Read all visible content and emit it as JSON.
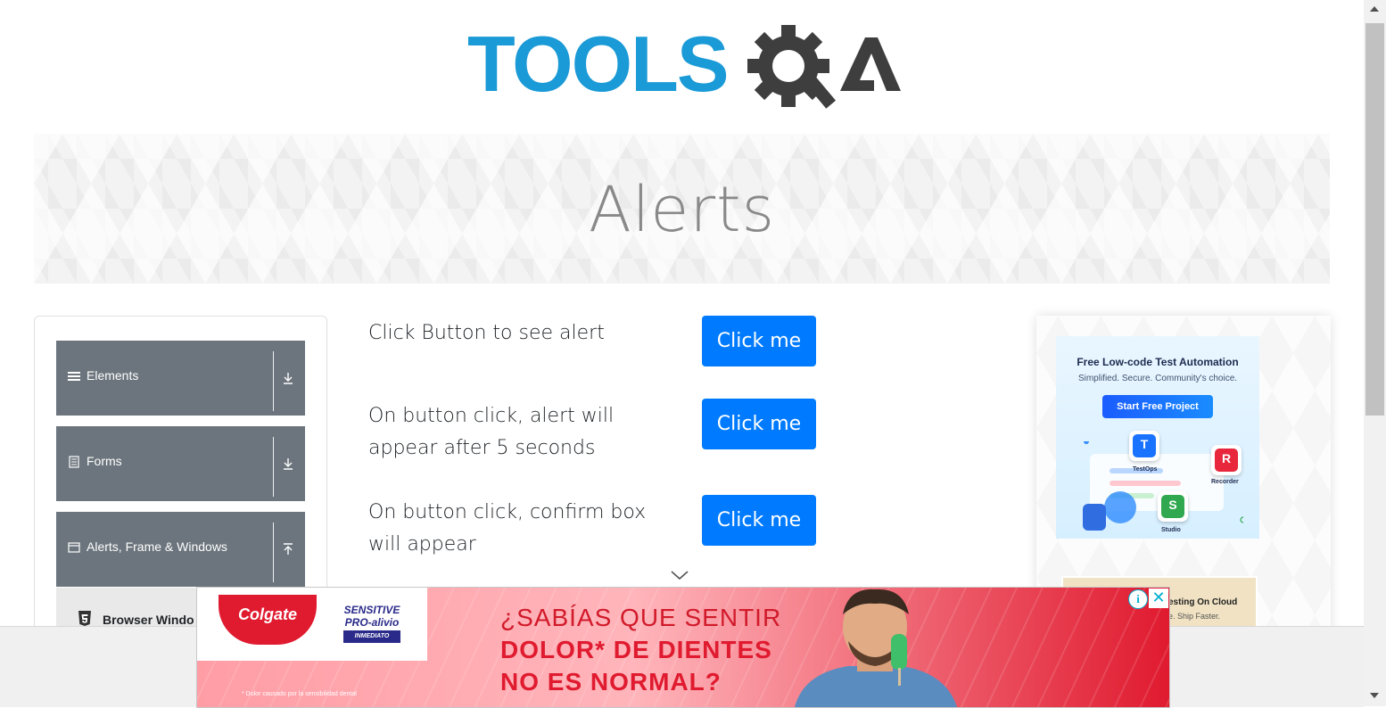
{
  "brand": {
    "logo_text_left": "TOOLS",
    "logo_text_right": "QA",
    "colors": {
      "blue": "#1a9ad6",
      "dark": "#3e3e3e"
    }
  },
  "banner": {
    "title": "Alerts"
  },
  "sidebar": {
    "groups": [
      {
        "label": "Elements",
        "icon": "hamburger-icon",
        "arrow": "download-arrow-icon"
      },
      {
        "label": "Forms",
        "icon": "form-icon",
        "arrow": "download-arrow-icon"
      },
      {
        "label": "Alerts, Frame & Windows",
        "icon": "window-icon",
        "arrow": "upload-arrow-icon"
      }
    ],
    "sub_item": {
      "label": "Browser Windo",
      "icon": "html5-icon"
    }
  },
  "main": {
    "rows": [
      {
        "text_lines": [
          "Click Button to see alert"
        ],
        "button": "Click me"
      },
      {
        "text_lines": [
          "On button click, alert will",
          "appear after 5 seconds"
        ],
        "button": "Click me"
      },
      {
        "text_lines": [
          "On button click, confirm box",
          "will appear"
        ],
        "button": "Click me"
      }
    ],
    "accent": "#007bff"
  },
  "right_ads": {
    "card1": {
      "title": "Free Low-code Test Automation",
      "subtitle": "Simplified. Secure. Community's choice.",
      "cta": "Start Free Project",
      "tiles": [
        "TestOps",
        "Recorder",
        "Studio"
      ],
      "tile_letters": [
        "T",
        "R",
        "S"
      ]
    },
    "card2": {
      "line1": "esting On Cloud",
      "line2": "e. Ship Faster."
    }
  },
  "bottom_ad": {
    "brand": "Colgate",
    "product_line1": "SENSITIVE",
    "product_line2": "PRO-alivio",
    "product_line3": "INMEDIATO",
    "headline_line1": "¿SABÍAS QUE SENTIR",
    "headline_line2": "DOLOR* DE DIENTES",
    "headline_line3": "NO ES NORMAL?",
    "footnote": "* Dolor causado por la sensibilidad dental",
    "info_glyph": "i",
    "close_glyph": "✕"
  }
}
